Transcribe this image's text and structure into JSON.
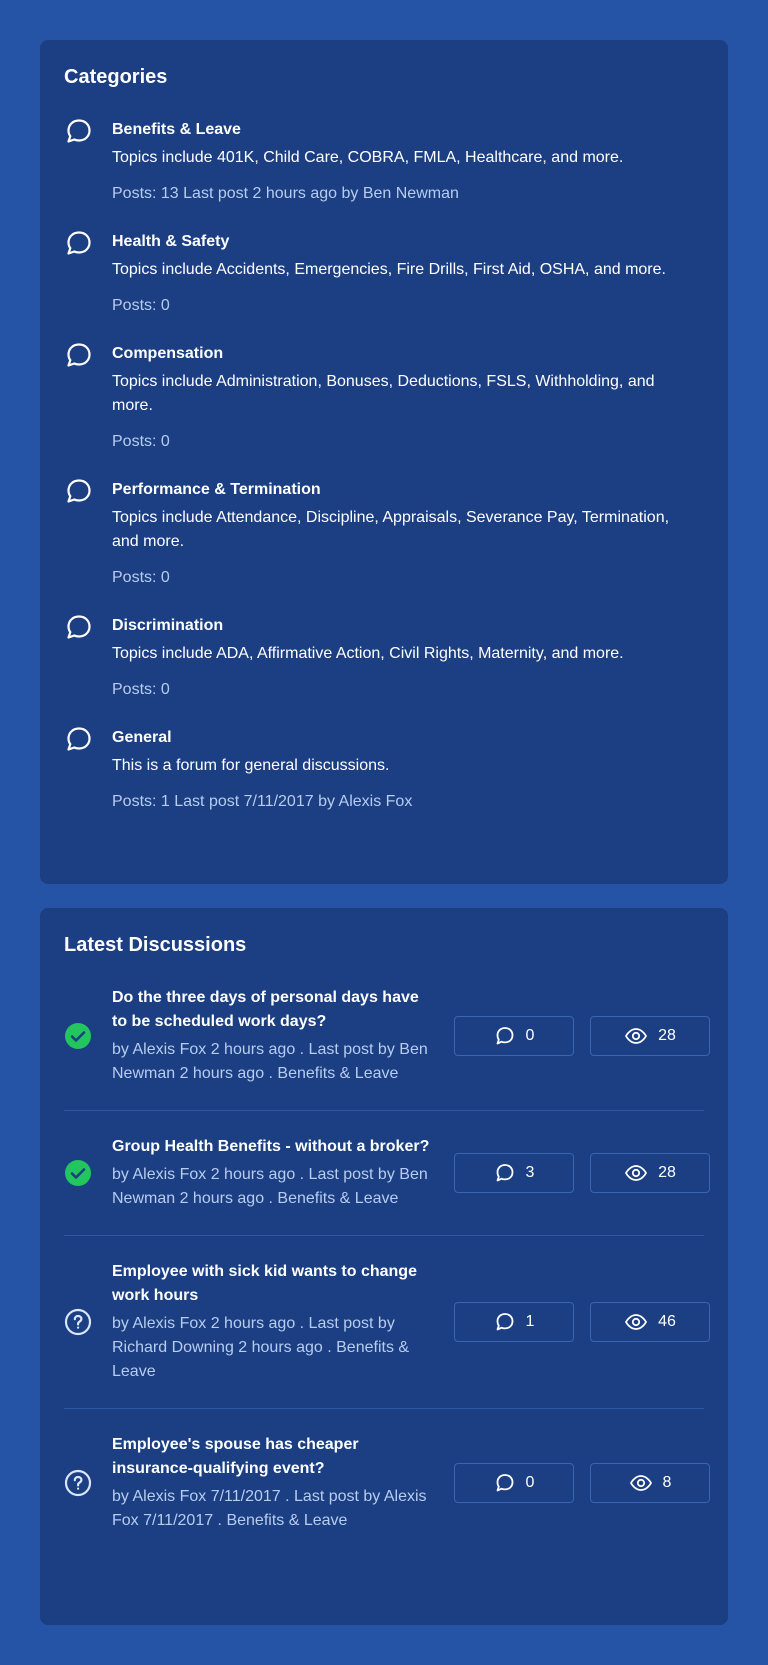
{
  "categories": {
    "title": "Categories",
    "items": [
      {
        "name": "Benefits & Leave",
        "description": "Topics include 401K, Child Care, COBRA, FMLA, Healthcare, and more.",
        "meta": "Posts: 13 Last post 2 hours ago by Ben Newman"
      },
      {
        "name": "Health & Safety",
        "description": "Topics include Accidents, Emergencies, Fire Drills, First Aid, OSHA, and more.",
        "meta": "Posts: 0"
      },
      {
        "name": "Compensation",
        "description": "Topics include Administration, Bonuses, Deductions, FSLS, Withholding, and more.",
        "meta": "Posts: 0"
      },
      {
        "name": "Performance & Termination",
        "description": "Topics include Attendance, Discipline, Appraisals, Severance Pay, Termination, and more.",
        "meta": "Posts: 0"
      },
      {
        "name": "Discrimination",
        "description": "Topics include ADA, Affirmative Action, Civil Rights, Maternity, and more.",
        "meta": "Posts: 0"
      },
      {
        "name": "General",
        "description": "This is a forum for general discussions.",
        "meta": "Posts: 1 Last post 7/11/2017 by Alexis Fox"
      }
    ]
  },
  "discussions": {
    "title": "Latest Discussions",
    "items": [
      {
        "status_icon": "check-circle-icon",
        "title": "Do the three days of personal days have to be scheduled work days?",
        "meta": "by Alexis Fox 2 hours ago  . Last post by Ben Newman 2 hours ago  . Benefits & Leave",
        "comments": "0",
        "views": "28"
      },
      {
        "status_icon": "check-circle-icon",
        "title": "Group Health Benefits - without a broker?",
        "meta": "by Alexis Fox 2 hours ago  . Last post by Ben Newman 2 hours ago  . Benefits & Leave",
        "comments": "3",
        "views": "28"
      },
      {
        "status_icon": "question-circle-icon",
        "title": "Employee with sick kid wants to change work hours",
        "meta": "by Alexis Fox 2 hours ago  . Last post by Richard Downing 2 hours ago  . Benefits & Leave",
        "comments": "1",
        "views": "46"
      },
      {
        "status_icon": "question-circle-icon",
        "title": "Employee's spouse has cheaper insurance-qualifying event?",
        "meta": "by Alexis Fox 7/11/2017  . Last post by Alexis Fox 7/11/2017  . Benefits & Leave",
        "comments": "0",
        "views": "8"
      }
    ]
  },
  "colors": {
    "page_background": "#2554a6",
    "card_background": "#1b3f82",
    "meta_text": "#b7ccf0",
    "answered_green": "#22c55e"
  }
}
